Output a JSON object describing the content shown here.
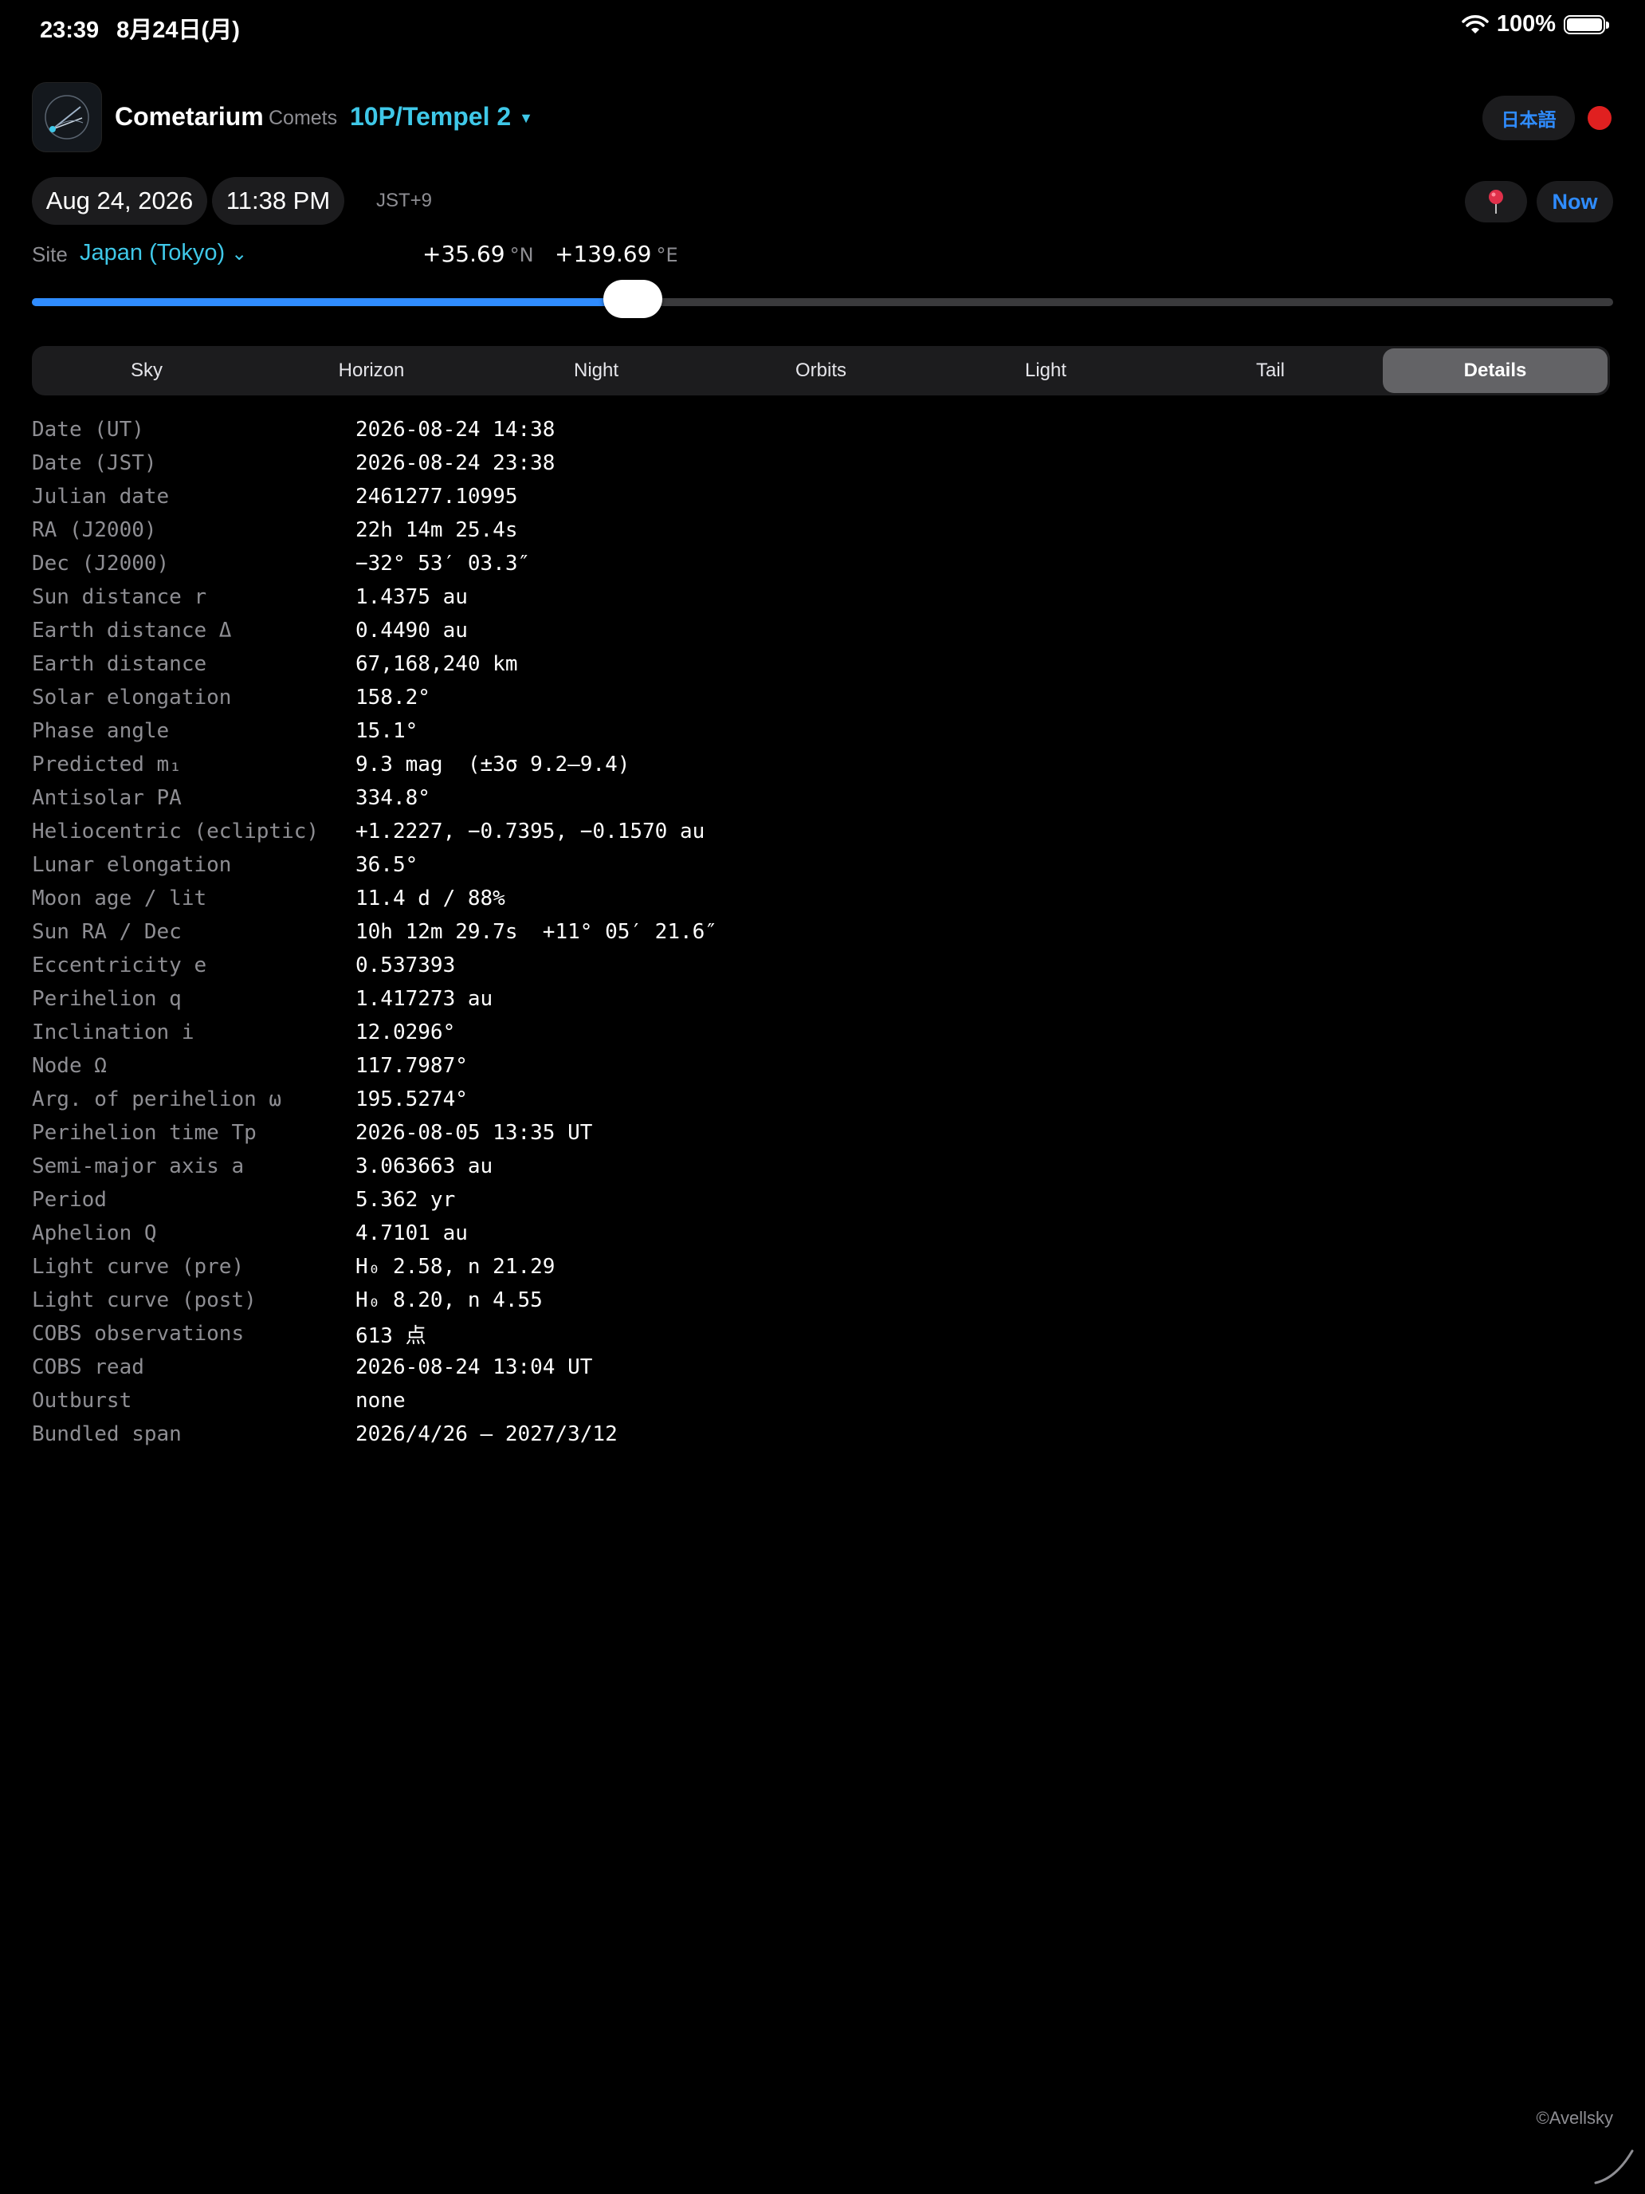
{
  "status_bar": {
    "time": "23:39",
    "date": "8月24日(月)",
    "battery": "100%"
  },
  "header": {
    "app_title": "Cometarium",
    "section_label": "Comets",
    "comet": "10P/Tempel 2",
    "language_button": "日本語"
  },
  "datetime": {
    "date": "Aug 24, 2026",
    "time": "11:38 PM",
    "timezone": "JST+9",
    "now_button": "Now"
  },
  "site": {
    "label": "Site",
    "name": "Japan (Tokyo)",
    "latitude": "+35.69",
    "lat_unit": "°N",
    "longitude": "+139.69",
    "lon_unit": "°E"
  },
  "time_slider": {
    "progress": 0.38
  },
  "tabs": [
    {
      "label": "Sky"
    },
    {
      "label": "Horizon"
    },
    {
      "label": "Night"
    },
    {
      "label": "Orbits"
    },
    {
      "label": "Light"
    },
    {
      "label": "Tail"
    },
    {
      "label": "Details",
      "active": true
    }
  ],
  "details": [
    {
      "key": "Date (UT)",
      "value": "2026-08-24 14:38"
    },
    {
      "key": "Date (JST)",
      "value": "2026-08-24 23:38"
    },
    {
      "key": "Julian date",
      "value": "2461277.10995"
    },
    {
      "key": "RA (J2000)",
      "value": "22h 14m 25.4s"
    },
    {
      "key": "Dec (J2000)",
      "value": "−32° 53′ 03.3″"
    },
    {
      "key": "Sun distance r",
      "value": "1.4375 au"
    },
    {
      "key": "Earth distance Δ",
      "value": "0.4490 au"
    },
    {
      "key": "Earth distance",
      "value": "67,168,240 km"
    },
    {
      "key": "Solar elongation",
      "value": "158.2°"
    },
    {
      "key": "Phase angle",
      "value": "15.1°"
    },
    {
      "key": "Predicted m₁",
      "value": "9.3 mag  (±3σ 9.2–9.4)"
    },
    {
      "key": "Antisolar PA",
      "value": "334.8°"
    },
    {
      "key": "Heliocentric (ecliptic)",
      "value": "+1.2227, −0.7395, −0.1570 au"
    },
    {
      "key": "Lunar elongation",
      "value": "36.5°"
    },
    {
      "key": "Moon age / lit",
      "value": "11.4 d / 88%"
    },
    {
      "key": "Sun RA / Dec",
      "value": "10h 12m 29.7s  +11° 05′ 21.6″"
    },
    {
      "key": "Eccentricity e",
      "value": "0.537393"
    },
    {
      "key": "Perihelion q",
      "value": "1.417273 au"
    },
    {
      "key": "Inclination i",
      "value": "12.0296°"
    },
    {
      "key": "Node Ω",
      "value": "117.7987°"
    },
    {
      "key": "Arg. of perihelion ω",
      "value": "195.5274°"
    },
    {
      "key": "Perihelion time Tp",
      "value": "2026-08-05 13:35 UT"
    },
    {
      "key": "Semi-major axis a",
      "value": "3.063663 au"
    },
    {
      "key": "Period",
      "value": "5.362 yr"
    },
    {
      "key": "Aphelion Q",
      "value": "4.7101 au"
    },
    {
      "key": "Light curve (pre)",
      "value": "H₀ 2.58, n 21.29"
    },
    {
      "key": "Light curve (post)",
      "value": "H₀ 8.20, n 4.55"
    },
    {
      "key": "COBS observations",
      "value": "613 点"
    },
    {
      "key": "COBS read",
      "value": "2026-08-24 13:04 UT"
    },
    {
      "key": "Outburst",
      "value": "none"
    },
    {
      "key": "Bundled span",
      "value": "2026/4/26 – 2027/3/12"
    }
  ],
  "footer": {
    "copyright": "©Avellsky"
  },
  "colors": {
    "accent": "#2f8cff",
    "cyan": "#3fc8e8",
    "record": "#e02020"
  }
}
